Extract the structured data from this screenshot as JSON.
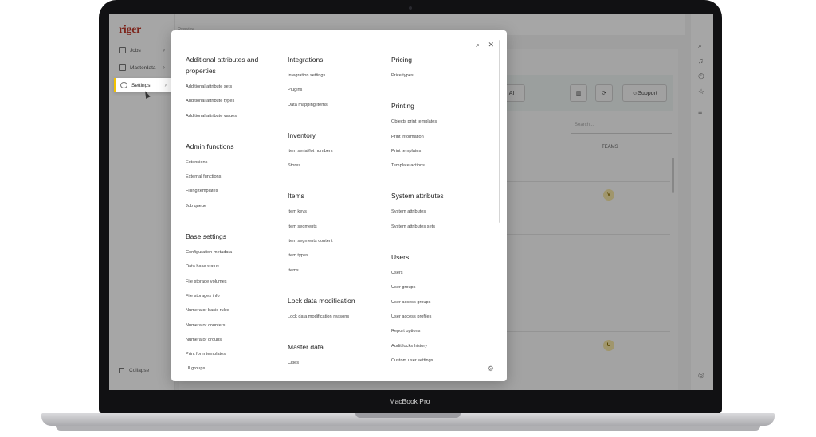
{
  "device": {
    "label": "MacBook Pro"
  },
  "app": {
    "logo": "riger",
    "tabs_label": "Overview",
    "nav": [
      {
        "label": "Jobs",
        "icon": "briefcase-icon"
      },
      {
        "label": "Masterdata",
        "icon": "book-icon"
      },
      {
        "label": "Settings",
        "icon": "gear-icon"
      }
    ],
    "collapse_label": "Collapse",
    "toolbar": {
      "ai_label": "AI",
      "support_label": "Support"
    },
    "search_placeholder": "Search...",
    "teams_header": "TEAMS",
    "avatars": [
      "V",
      "U"
    ]
  },
  "menu": {
    "columns": [
      [
        {
          "title": "Additional attributes and properties",
          "items": [
            "Additional attribute sets",
            "Additional attribute types",
            "Additional attribute values"
          ]
        },
        {
          "title": "Admin functions",
          "items": [
            "Extensions",
            "External functions",
            "Filling templates",
            "Job queue"
          ]
        },
        {
          "title": "Base settings",
          "items": [
            "Configuration metadata",
            "Data base status",
            "File storage volumes",
            "File storages info",
            "Numerator basic rules",
            "Numerator counters",
            "Numerator groups",
            "Print form templates",
            "UI groups"
          ]
        }
      ],
      [
        {
          "title": "Integrations",
          "items": [
            "Integration settings",
            "Plugins",
            "Data mapping items"
          ]
        },
        {
          "title": "Inventory",
          "items": [
            "Item serial/lot numbers",
            "Stores"
          ]
        },
        {
          "title": "Items",
          "items": [
            "Item keys",
            "Item segments",
            "Item segments content",
            "Item types",
            "Items"
          ]
        },
        {
          "title": "Lock data modification",
          "items": [
            "Lock data modification reasons"
          ]
        },
        {
          "title": "Master data",
          "items": [
            "Cities"
          ]
        }
      ],
      [
        {
          "title": "Pricing",
          "items": [
            "Price types"
          ]
        },
        {
          "title": "Printing",
          "items": [
            "Objects print templates",
            "Print information",
            "Print templates",
            "Template actions"
          ]
        },
        {
          "title": "System attributes",
          "items": [
            "System attributes",
            "System attributes sets"
          ]
        },
        {
          "title": "Users",
          "items": [
            "Users",
            "User groups",
            "User access groups",
            "User access profiles",
            "Report options",
            "Audit locks history",
            "Custom user settings"
          ]
        }
      ]
    ]
  }
}
